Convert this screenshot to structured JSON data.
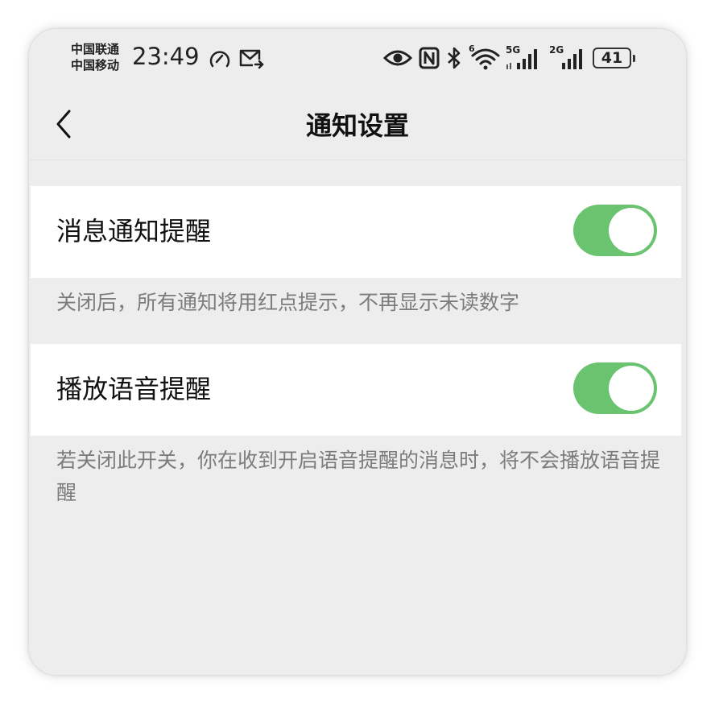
{
  "status_bar": {
    "carrier_1": "中国联通",
    "carrier_2": "中国移动",
    "time": "23:49",
    "network_1": "5G",
    "network_2": "2G",
    "wifi_badge": "6",
    "battery": "41"
  },
  "nav": {
    "title": "通知设置"
  },
  "settings": [
    {
      "label": "消息通知提醒",
      "enabled": true,
      "hint": "关闭后，所有通知将用红点提示，不再显示未读数字"
    },
    {
      "label": "播放语音提醒",
      "enabled": true,
      "hint": "若关闭此开关，你在收到开启语音提醒的消息时，将不会播放语音提醒"
    }
  ],
  "colors": {
    "toggle_on": "#6ac46f",
    "background": "#ededed",
    "row_background": "#ffffff"
  }
}
